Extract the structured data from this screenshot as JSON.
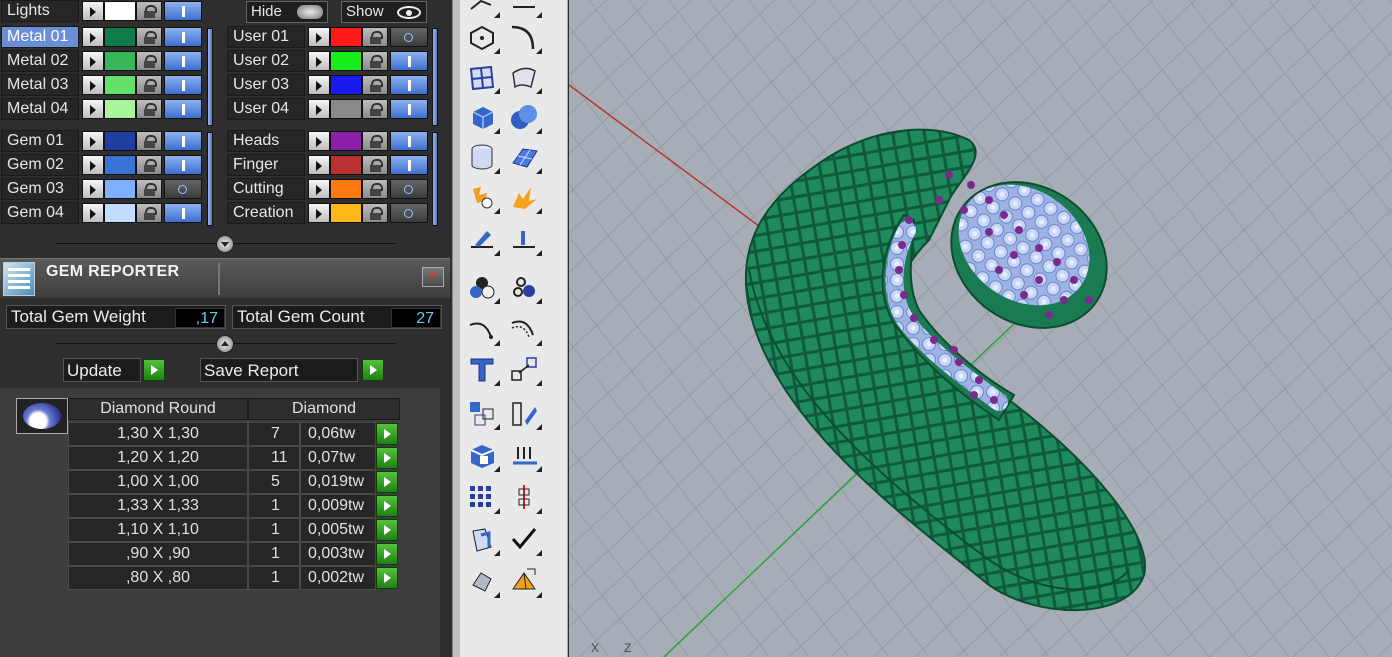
{
  "layers": {
    "lights": {
      "label": "Lights",
      "color": "#ffffff"
    },
    "hide_label": "Hide",
    "show_label": "Show",
    "left_col": [
      {
        "label": "Metal 01",
        "color": "#0f7a4a",
        "selected": true
      },
      {
        "label": "Metal 02",
        "color": "#36b85a"
      },
      {
        "label": "Metal 03",
        "color": "#62e06a"
      },
      {
        "label": "Metal 04",
        "color": "#a8f59c"
      },
      {
        "label": "Gem 01",
        "color": "#1f3fa3"
      },
      {
        "label": "Gem 02",
        "color": "#3a73d6"
      },
      {
        "label": "Gem 03",
        "color": "#7fb0ff",
        "vis_off": true
      },
      {
        "label": "Gem 04",
        "color": "#c4dcff"
      }
    ],
    "right_col": [
      {
        "label": "User 01",
        "color": "#ff1a1a",
        "vis_off": true
      },
      {
        "label": "User 02",
        "color": "#1aee1a"
      },
      {
        "label": "User 03",
        "color": "#1a1aee"
      },
      {
        "label": "User 04",
        "color": "#8a8a8a"
      },
      {
        "label": "Heads",
        "color": "#8a1fa8"
      },
      {
        "label": "Finger",
        "color": "#b83030"
      },
      {
        "label": "Cutting",
        "color": "#ff7a10",
        "vis_off": true
      },
      {
        "label": "Creation",
        "color": "#ffb81a",
        "vis_off": true
      }
    ]
  },
  "gem_reporter": {
    "title": "GEM REPORTER",
    "close": "×",
    "total_weight_label": "Total Gem Weight",
    "total_weight_value": ",17",
    "total_count_label": "Total Gem Count",
    "total_count_value": "27",
    "update_label": "Update",
    "save_label": "Save Report",
    "table": {
      "col1_header": "Diamond Round",
      "col2_header": "Diamond",
      "rows": [
        {
          "size": "1,30 X 1,30",
          "count": "7",
          "weight": "0,06tw"
        },
        {
          "size": "1,20 X 1,20",
          "count": "11",
          "weight": "0,07tw"
        },
        {
          "size": "1,00 X 1,00",
          "count": "5",
          "weight": "0,019tw"
        },
        {
          "size": "1,33 X 1,33",
          "count": "1",
          "weight": "0,009tw"
        },
        {
          "size": "1,10 X 1,10",
          "count": "1",
          "weight": "0,005tw"
        },
        {
          "size": ",90 X ,90",
          "count": "1",
          "weight": "0,003tw"
        },
        {
          "size": ",80 X ,80",
          "count": "1",
          "weight": "0,002tw"
        }
      ]
    }
  },
  "viewport": {
    "axis_x": "X",
    "axis_z": "Z",
    "ring_color": "#1f8a5e",
    "gem_color": "#b9ccf4",
    "prong_color": "#7a2a8e"
  }
}
